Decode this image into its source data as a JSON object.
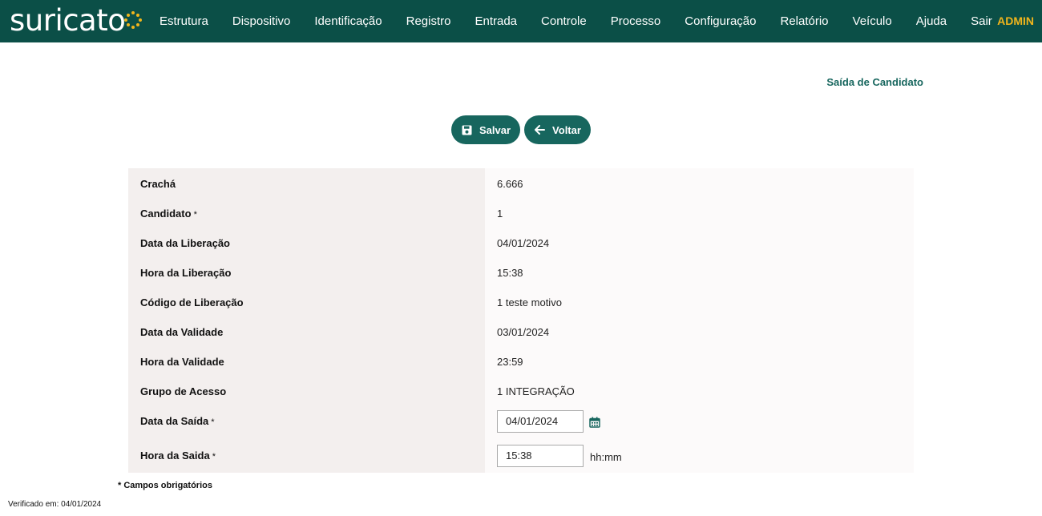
{
  "brand": {
    "name": "suricato"
  },
  "nav": {
    "items": [
      "Estrutura",
      "Dispositivo",
      "Identificação",
      "Registro",
      "Entrada",
      "Controle",
      "Processo",
      "Configuração",
      "Relatório",
      "Veículo",
      "Ajuda",
      "Sair"
    ],
    "user": "ADMIN"
  },
  "page": {
    "title": "Saída de Candidato"
  },
  "actions": {
    "save_label": "Salvar",
    "back_label": "Voltar"
  },
  "form": {
    "rows": [
      {
        "label": "Crachá",
        "value": "6.666"
      },
      {
        "label": "Candidato",
        "required": "*",
        "value": "1"
      },
      {
        "label": "Data da Liberação",
        "value": "04/01/2024"
      },
      {
        "label": "Hora da Liberação",
        "value": "15:38"
      },
      {
        "label": "Código de Liberação",
        "value": "1 teste motivo"
      },
      {
        "label": "Data da Validade",
        "value": "03/01/2024"
      },
      {
        "label": "Hora da Validade",
        "value": "23:59"
      },
      {
        "label": "Grupo de Acesso",
        "value": "1 INTEGRAÇÃO"
      },
      {
        "label": "Data da Saída",
        "required": "*",
        "value": "04/01/2024"
      },
      {
        "label": "Hora da Saida",
        "required": "*",
        "value": "15:38"
      }
    ],
    "time_hint": "hh:mm"
  },
  "footer": {
    "required_note": "* Campos obrigatórios",
    "verified": "Verificado em: 04/01/2024"
  },
  "colors": {
    "header_bg": "#0b4f47",
    "accent": "#17665e",
    "highlight": "#f1b51c"
  }
}
